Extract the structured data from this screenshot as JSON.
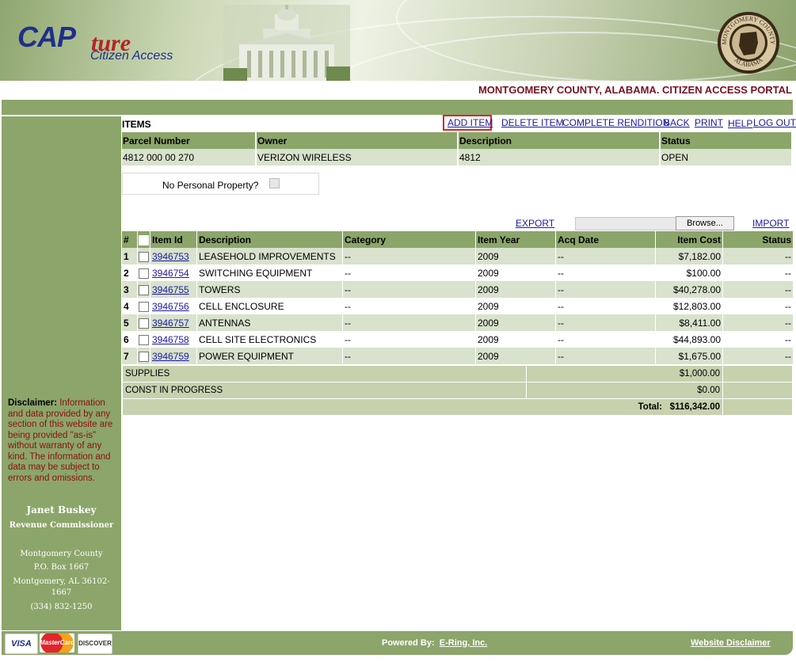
{
  "header": {
    "logo_cap": "CAP",
    "logo_ture": "ture",
    "logo_sub": "Citizen Access",
    "seal_top": "MONTGOMERY COUNTY",
    "seal_bottom": "ALABAMA",
    "portal_title": "MONTGOMERY COUNTY, ALABAMA. CITIZEN ACCESS PORTAL"
  },
  "sidebar": {
    "disclaimer_label": "Disclaimer:",
    "disclaimer_text": " Information and data provided by any section of this website are being provided \"as-is\" without warranty of any kind. The information and data may be subject to errors and omissions.",
    "name": "Janet Buskey",
    "role": "Revenue Commissioner",
    "addr1": "Montgomery County",
    "addr2": "P.O. Box 1667",
    "addr3": "Montgomery, AL 36102-1667",
    "phone": "(334) 832-1250"
  },
  "toolbar": {
    "title": "ITEMS",
    "add_item": "ADD ITEM",
    "delete_item": "DELETE ITEM",
    "complete_rendition": "COMPLETE RENDITION",
    "back": "BACK",
    "print": "PRINT",
    "help": "HELP",
    "logout": "LOG OUT"
  },
  "parcel": {
    "headers": [
      "Parcel Number",
      "Owner",
      "Description",
      "Status"
    ],
    "values": [
      "4812 000 00 270",
      "VERIZON WIRELESS",
      "4812",
      "OPEN"
    ]
  },
  "npp_label": "No Personal Property?",
  "file_ops": {
    "export": "EXPORT",
    "browse": "Browse...",
    "import": "IMPORT"
  },
  "items": {
    "headers": [
      "#",
      "Item Id",
      "Description",
      "Category",
      "Item Year",
      "Acq Date",
      "Item Cost",
      "Status"
    ],
    "rows": [
      {
        "n": "1",
        "id": "3946753",
        "desc": "LEASEHOLD IMPROVEMENTS",
        "cat": "--",
        "year": "2009",
        "acq": "--",
        "cost": "$7,182.00",
        "status": "--"
      },
      {
        "n": "2",
        "id": "3946754",
        "desc": "SWITCHING EQUIPMENT",
        "cat": "--",
        "year": "2009",
        "acq": "--",
        "cost": "$100.00",
        "status": "--"
      },
      {
        "n": "3",
        "id": "3946755",
        "desc": "TOWERS",
        "cat": "--",
        "year": "2009",
        "acq": "--",
        "cost": "$40,278.00",
        "status": "--"
      },
      {
        "n": "4",
        "id": "3946756",
        "desc": "CELL ENCLOSURE",
        "cat": "--",
        "year": "2009",
        "acq": "--",
        "cost": "$12,803.00",
        "status": "--"
      },
      {
        "n": "5",
        "id": "3946757",
        "desc": "ANTENNAS",
        "cat": "--",
        "year": "2009",
        "acq": "--",
        "cost": "$8,411.00",
        "status": "--"
      },
      {
        "n": "6",
        "id": "3946758",
        "desc": "CELL SITE ELECTRONICS",
        "cat": "--",
        "year": "2009",
        "acq": "--",
        "cost": "$44,893.00",
        "status": "--"
      },
      {
        "n": "7",
        "id": "3946759",
        "desc": "POWER EQUIPMENT",
        "cat": "--",
        "year": "2009",
        "acq": "--",
        "cost": "$1,675.00",
        "status": "--"
      }
    ]
  },
  "summary": {
    "supplies_label": "SUPPLIES",
    "supplies_value": "$1,000.00",
    "cip_label": "CONST IN PROGRESS",
    "cip_value": "$0.00",
    "total_label": "Total:",
    "total_value": "$116,342.00"
  },
  "footer": {
    "visa": "VISA",
    "mastercard": "MasterCard",
    "discover": "DISCOVER",
    "powered_by": "Powered By:",
    "vendor": "E-Ring, Inc.",
    "website_disclaimer": "Website Disclaimer"
  },
  "colors": {
    "green": "#8ca56a",
    "light_green": "#d8e2cd",
    "title_red": "#7a1020",
    "highlight": "#d8272f"
  }
}
